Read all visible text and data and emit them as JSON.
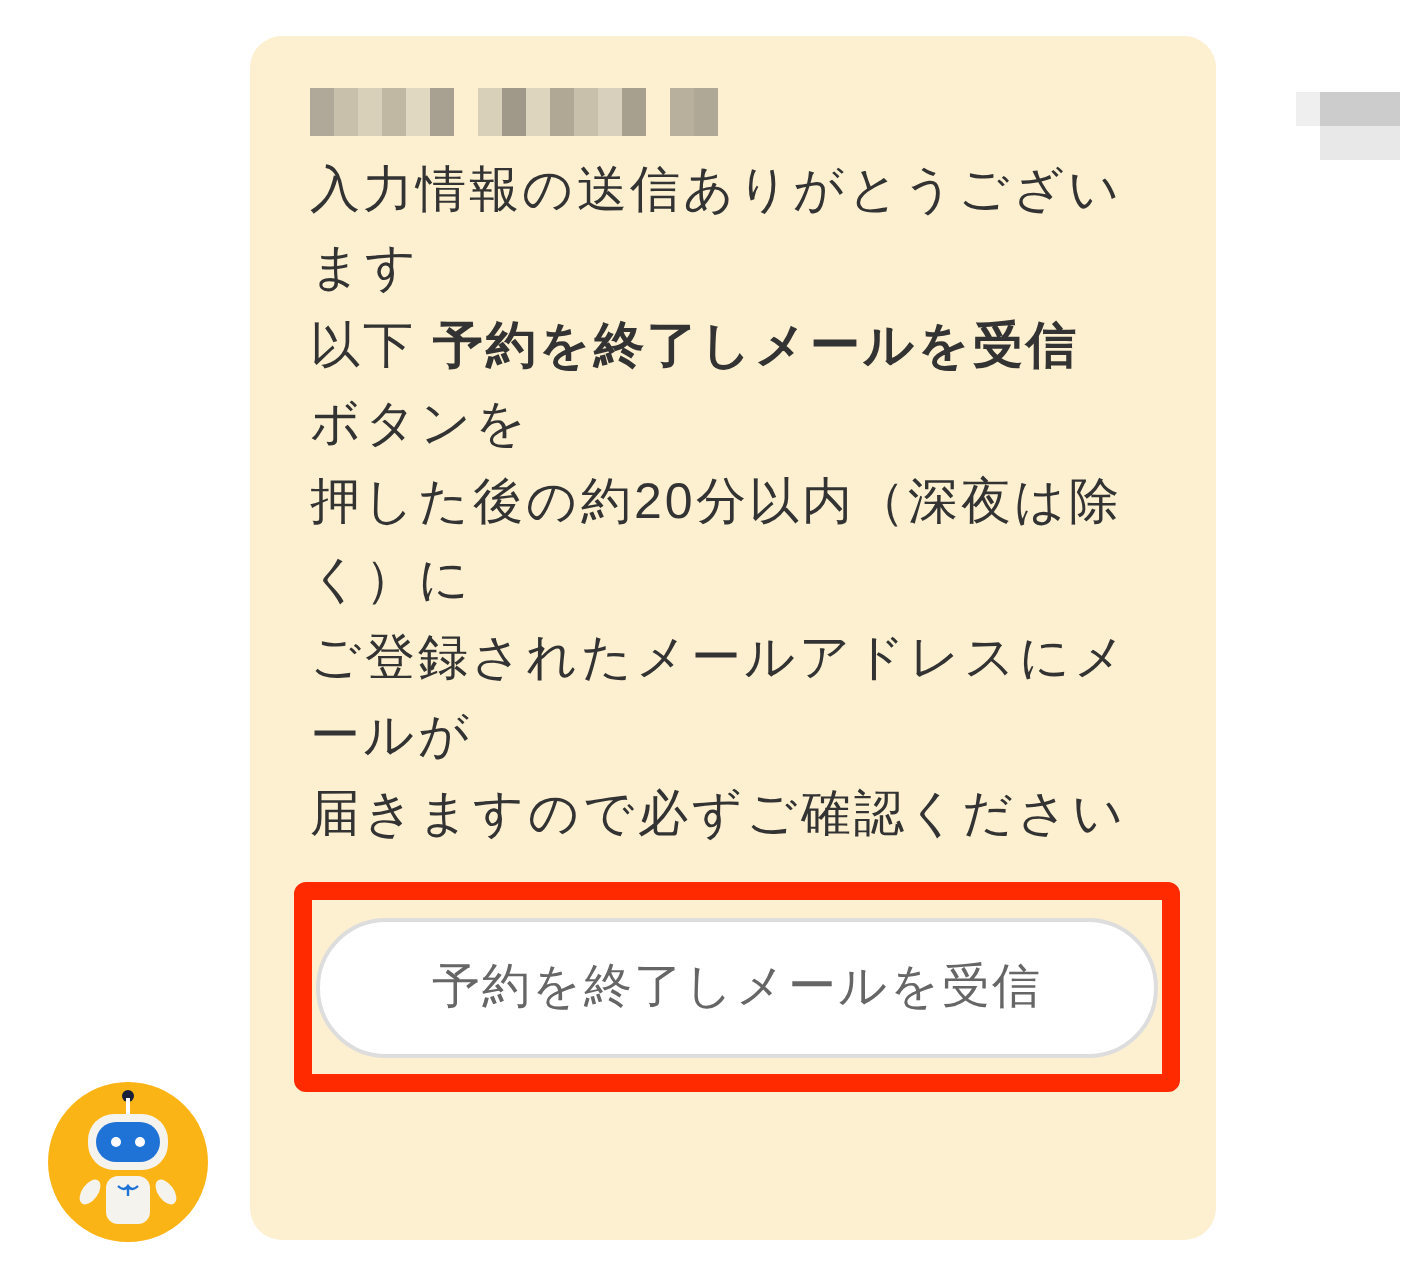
{
  "message": {
    "lines": [
      "入力情報の送信ありがとうござい",
      "ます",
      "以下 **予約を終了しメールを受信**",
      "ボタンを",
      "押した後の約20分以内（深夜は除",
      "く）に",
      "ご登録されたメールアドレスにメ",
      "ールが",
      "届きますので必ずご確認ください"
    ],
    "button": {
      "label": "予約を終了しメールを受信",
      "highlighted": true
    }
  }
}
